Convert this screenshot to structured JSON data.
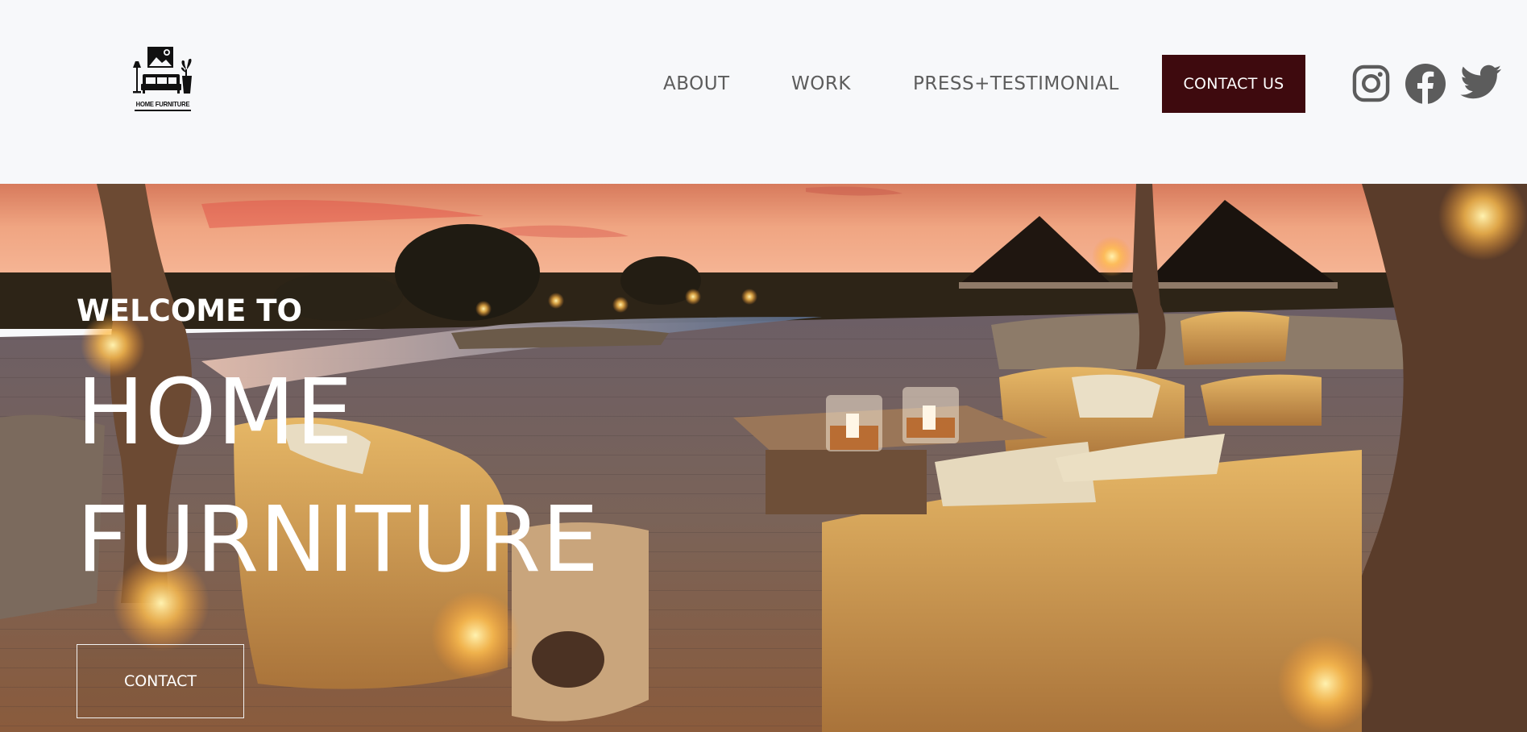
{
  "brand": {
    "logo_icon": "home-furniture-logo",
    "logo_text": "HOME FURNITURE"
  },
  "nav": {
    "about": "ABOUT",
    "work": "WORK",
    "press": "PRESS+TESTIMONIAL",
    "contact_us": "CONTACT US"
  },
  "social": {
    "instagram_icon": "instagram-icon",
    "facebook_icon": "facebook-icon",
    "twitter_icon": "twitter-icon"
  },
  "hero": {
    "welcome": "WELCOME TO",
    "title_line1": "HOME",
    "title_line2": "FURNITURE",
    "contact_button": "CONTACT"
  },
  "colors": {
    "background": "#f7f8fa",
    "accent": "#3e0a0e",
    "nav_text": "#5c5c5c",
    "hero_text": "#ffffff"
  }
}
